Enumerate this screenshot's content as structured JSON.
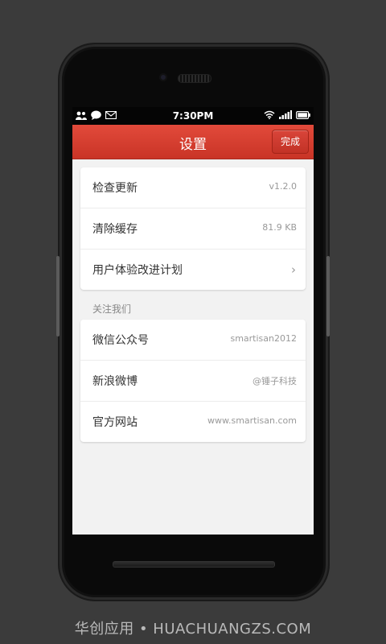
{
  "status_bar": {
    "time": "7:30PM",
    "left_icons": [
      "contacts-icon",
      "chat-icon",
      "mail-icon"
    ],
    "right_icons": [
      "wifi-icon",
      "signal-icon",
      "battery-icon"
    ]
  },
  "header": {
    "title": "设置",
    "done_label": "完成",
    "accent_color": "#d63c2f"
  },
  "settings": {
    "items": [
      {
        "label": "检查更新",
        "value": "v1.2.0"
      },
      {
        "label": "清除缓存",
        "value": "81.9 KB"
      },
      {
        "label": "用户体验改进计划",
        "value": ""
      }
    ]
  },
  "follow": {
    "header": "关注我们",
    "items": [
      {
        "label": "微信公众号",
        "value": "smartisan2012"
      },
      {
        "label": "新浪微博",
        "value": "@锤子科技"
      },
      {
        "label": "官方网站",
        "value": "www.smartisan.com"
      }
    ]
  },
  "watermark": "华创应用 • HUACHUANGZS.COM"
}
